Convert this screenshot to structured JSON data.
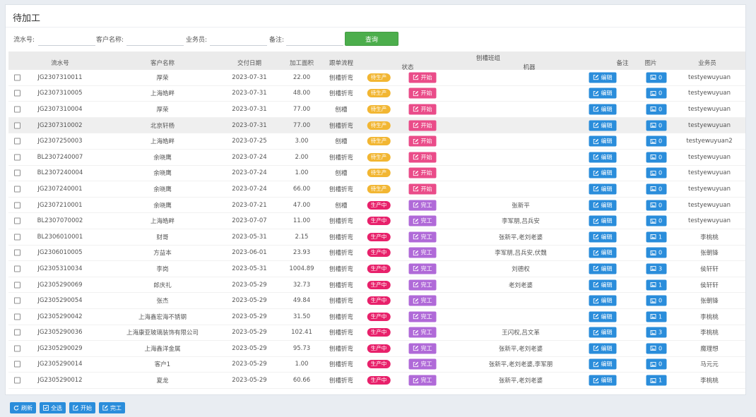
{
  "page": {
    "title": "待加工"
  },
  "filters": {
    "serial_label": "流水号:",
    "customer_label": "客户名称:",
    "salesman_label": "业务员:",
    "remark_label": "备注:",
    "query_label": "查询"
  },
  "table": {
    "headers": {
      "serial": "流水号",
      "customer": "客户名称",
      "date": "交付日期",
      "area": "加工面积",
      "process": "跟单流程",
      "status": "状态",
      "team": "刨槽班组",
      "machine": "机器",
      "remark": "备注",
      "pic": "图片",
      "salesman": "业务员"
    },
    "rows": [
      {
        "serial": "JG2307310011",
        "customer": "厚荣",
        "date": "2023-07-31",
        "area": "22.00",
        "process": "刨槽折弯",
        "status": "待生产",
        "action": "开始",
        "team": "",
        "edit": "编辑",
        "pics": "0",
        "salesman": "testyewuyuan"
      },
      {
        "serial": "JG2307310005",
        "customer": "上海皓畔",
        "date": "2023-07-31",
        "area": "48.00",
        "process": "刨槽折弯",
        "status": "待生产",
        "action": "开始",
        "team": "",
        "edit": "编辑",
        "pics": "0",
        "salesman": "testyewuyuan"
      },
      {
        "serial": "JG2307310004",
        "customer": "厚荣",
        "date": "2023-07-31",
        "area": "77.00",
        "process": "刨槽",
        "status": "待生产",
        "action": "开始",
        "team": "",
        "edit": "编辑",
        "pics": "0",
        "salesman": "testyewuyuan"
      },
      {
        "serial": "JG2307310002",
        "customer": "北京轩杨",
        "date": "2023-07-31",
        "area": "77.00",
        "process": "刨槽折弯",
        "status": "待生产",
        "action": "开始",
        "team": "",
        "edit": "编辑",
        "pics": "0",
        "salesman": "testyewuyuan"
      },
      {
        "serial": "JG2307250003",
        "customer": "上海皓畔",
        "date": "2023-07-25",
        "area": "3.00",
        "process": "刨槽",
        "status": "待生产",
        "action": "开始",
        "team": "",
        "edit": "编辑",
        "pics": "0",
        "salesman": "testyewuyuan2"
      },
      {
        "serial": "BL2307240007",
        "customer": "余晓鹰",
        "date": "2023-07-24",
        "area": "2.00",
        "process": "刨槽折弯",
        "status": "待生产",
        "action": "开始",
        "team": "",
        "edit": "编辑",
        "pics": "0",
        "salesman": "testyewuyuan"
      },
      {
        "serial": "BL2307240004",
        "customer": "余晓鹰",
        "date": "2023-07-24",
        "area": "1.00",
        "process": "刨槽",
        "status": "待生产",
        "action": "开始",
        "team": "",
        "edit": "编辑",
        "pics": "0",
        "salesman": "testyewuyuan"
      },
      {
        "serial": "JG2307240001",
        "customer": "余晓鹰",
        "date": "2023-07-24",
        "area": "66.00",
        "process": "刨槽折弯",
        "status": "待生产",
        "action": "开始",
        "team": "",
        "edit": "编辑",
        "pics": "0",
        "salesman": "testyewuyuan"
      },
      {
        "serial": "JG2307210001",
        "customer": "余晓鹰",
        "date": "2023-07-21",
        "area": "47.00",
        "process": "刨槽",
        "status": "生产中",
        "action": "完工",
        "team": "张新平",
        "edit": "编辑",
        "pics": "0",
        "salesman": "testyewuyuan"
      },
      {
        "serial": "BL2307070002",
        "customer": "上海皓畔",
        "date": "2023-07-07",
        "area": "11.00",
        "process": "刨槽折弯",
        "status": "生产中",
        "action": "完工",
        "team": "李军朋,吕兵安",
        "edit": "编辑",
        "pics": "0",
        "salesman": "testyewuyuan"
      },
      {
        "serial": "BL2306010001",
        "customer": "财哥",
        "date": "2023-05-31",
        "area": "2.15",
        "process": "刨槽折弯",
        "status": "生产中",
        "action": "完工",
        "team": "张新平,老刘老婆",
        "edit": "编辑",
        "pics": "1",
        "salesman": "李桃桃"
      },
      {
        "serial": "JG2306010005",
        "customer": "方益本",
        "date": "2023-06-01",
        "area": "23.93",
        "process": "刨槽折弯",
        "status": "生产中",
        "action": "完工",
        "team": "李军朋,吕兵安,伏魏",
        "edit": "编辑",
        "pics": "0",
        "salesman": "张朝锋"
      },
      {
        "serial": "JG2305310034",
        "customer": "李岗",
        "date": "2023-05-31",
        "area": "1004.89",
        "process": "刨槽折弯",
        "status": "生产中",
        "action": "完工",
        "team": "刘德权",
        "edit": "编辑",
        "pics": "3",
        "salesman": "侯轩轩"
      },
      {
        "serial": "JG2305290069",
        "customer": "郎庆礼",
        "date": "2023-05-29",
        "area": "32.73",
        "process": "刨槽折弯",
        "status": "生产中",
        "action": "完工",
        "team": "老刘老婆",
        "edit": "编辑",
        "pics": "1",
        "salesman": "侯轩轩"
      },
      {
        "serial": "JG2305290054",
        "customer": "张杰",
        "date": "2023-05-29",
        "area": "49.84",
        "process": "刨槽折弯",
        "status": "生产中",
        "action": "完工",
        "team": "",
        "edit": "编辑",
        "pics": "0",
        "salesman": "张朝锋"
      },
      {
        "serial": "JG2305290042",
        "customer": "上海鑫宏海不锈钢",
        "date": "2023-05-29",
        "area": "31.50",
        "process": "刨槽折弯",
        "status": "生产中",
        "action": "完工",
        "team": "",
        "edit": "编辑",
        "pics": "1",
        "salesman": "李桃桃"
      },
      {
        "serial": "JG2305290036",
        "customer": "上海康亚玻璃装饰有限公司",
        "date": "2023-05-29",
        "area": "102.41",
        "process": "刨槽折弯",
        "status": "生产中",
        "action": "完工",
        "team": "王闪权,吕文革",
        "edit": "编辑",
        "pics": "3",
        "salesman": "李桃桃"
      },
      {
        "serial": "JG2305290029",
        "customer": "上海鑫洋金属",
        "date": "2023-05-29",
        "area": "95.73",
        "process": "刨槽折弯",
        "status": "生产中",
        "action": "完工",
        "team": "张新平,老刘老婆",
        "edit": "编辑",
        "pics": "0",
        "salesman": "魔理想"
      },
      {
        "serial": "JG2305290014",
        "customer": "客户1",
        "date": "2023-05-29",
        "area": "1.00",
        "process": "刨槽折弯",
        "status": "生产中",
        "action": "完工",
        "team": "张新平,老刘老婆,李军朋",
        "edit": "编辑",
        "pics": "0",
        "salesman": "马元元"
      },
      {
        "serial": "JG2305290012",
        "customer": "夏龙",
        "date": "2023-05-29",
        "area": "60.66",
        "process": "刨槽折弯",
        "status": "生产中",
        "action": "完工",
        "team": "张新平,老刘老婆",
        "edit": "编辑",
        "pics": "1",
        "salesman": "李桃桃"
      }
    ]
  },
  "footer": {
    "refresh": "刷新",
    "select_all": "全选",
    "start": "开始",
    "finish": "完工"
  },
  "colors": {
    "pending": "#f2b632",
    "producing": "#e8216b",
    "start_button": "#ea4c89",
    "finish_button": "#b06ad8",
    "primary_button": "#2a8ddb",
    "query_button": "#4cae4c"
  },
  "icons": {
    "start": "pencil-square-icon",
    "finish": "pencil-square-icon",
    "edit": "pencil-square-icon",
    "pic": "image-icon",
    "refresh": "refresh-icon",
    "select_all": "check-square-icon"
  }
}
